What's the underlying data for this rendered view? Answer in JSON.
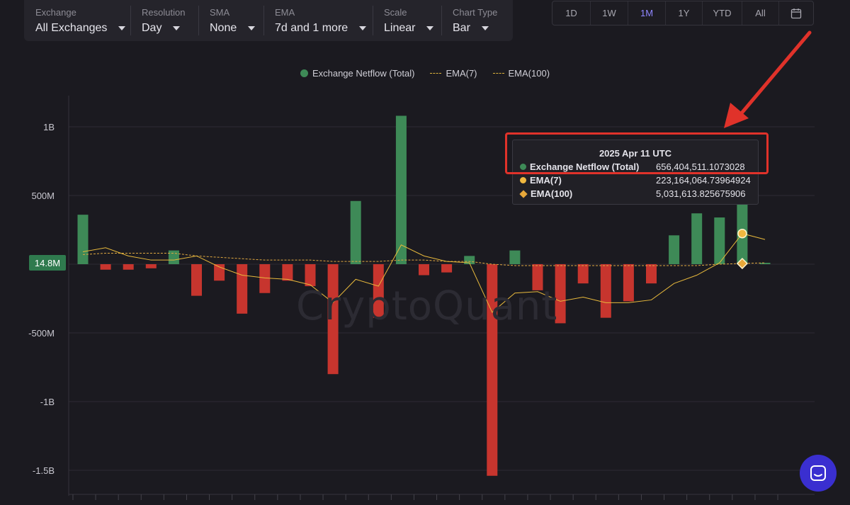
{
  "filters": [
    {
      "label": "Exchange",
      "value": "All Exchanges"
    },
    {
      "label": "Resolution",
      "value": "Day"
    },
    {
      "label": "SMA",
      "value": "None"
    },
    {
      "label": "EMA",
      "value": "7d and 1 more"
    },
    {
      "label": "Scale",
      "value": "Linear"
    },
    {
      "label": "Chart Type",
      "value": "Bar"
    }
  ],
  "ranges": [
    "1D",
    "1W",
    "1M",
    "1Y",
    "YTD",
    "All"
  ],
  "active_range": "1M",
  "calendar_icon": "calendar-icon",
  "watermark": "CryptoQuant",
  "current_value_label": "14.8M",
  "tooltip": {
    "title": "2025 Apr 11 UTC",
    "rows": [
      {
        "name": "Exchange Netflow (Total)",
        "value": "656,404,511.1073028"
      },
      {
        "name": "EMA(7)",
        "value": "223,164,064.73964924"
      },
      {
        "name": "EMA(100)",
        "value": "5,031,613.825675906"
      }
    ]
  },
  "colors": {
    "positive": "#3e8a57",
    "negative": "#c7352e",
    "ema7": "#e8b93c",
    "ema100": "#e0a840",
    "accent": "#8f86ff",
    "highlight": "#e0322a",
    "chat": "#3a2fd0"
  },
  "chart_data": {
    "type": "bar",
    "legend": [
      "Exchange Netflow (Total)",
      "EMA(7)",
      "EMA(100)"
    ],
    "legend_position": "top-center",
    "y_ticks": [
      "1B",
      "500M",
      "-500M",
      "-1B",
      "-1.5B"
    ],
    "ylim": [
      -1650000000,
      1150000000
    ],
    "grid": true,
    "series": [
      {
        "name": "Exchange Netflow (Total)",
        "values": [
          360000000,
          -40000000,
          -40000000,
          -30000000,
          100000000,
          -230000000,
          -120000000,
          -360000000,
          -210000000,
          -120000000,
          -160000000,
          -800000000,
          460000000,
          -390000000,
          1080000000,
          -80000000,
          -60000000,
          60000000,
          -1540000000,
          100000000,
          -190000000,
          -430000000,
          -140000000,
          -390000000,
          -270000000,
          -140000000,
          210000000,
          370000000,
          340000000,
          656404511,
          10000000
        ]
      },
      {
        "name": "EMA(7)",
        "values": [
          90000000,
          120000000,
          60000000,
          30000000,
          30000000,
          60000000,
          -20000000,
          -80000000,
          -100000000,
          -110000000,
          -150000000,
          -280000000,
          -110000000,
          -160000000,
          140000000,
          60000000,
          20000000,
          10000000,
          -350000000,
          -210000000,
          -200000000,
          -270000000,
          -240000000,
          -280000000,
          -280000000,
          -260000000,
          -140000000,
          -80000000,
          10000000,
          223164064,
          180000000
        ]
      },
      {
        "name": "EMA(100)",
        "values": [
          70000000,
          80000000,
          80000000,
          80000000,
          80000000,
          60000000,
          50000000,
          40000000,
          30000000,
          30000000,
          30000000,
          20000000,
          20000000,
          20000000,
          30000000,
          30000000,
          20000000,
          20000000,
          0,
          -10000000,
          -10000000,
          -10000000,
          -10000000,
          -10000000,
          -10000000,
          -10000000,
          -10000000,
          -10000000,
          0,
          5031613,
          10000000
        ]
      }
    ]
  }
}
